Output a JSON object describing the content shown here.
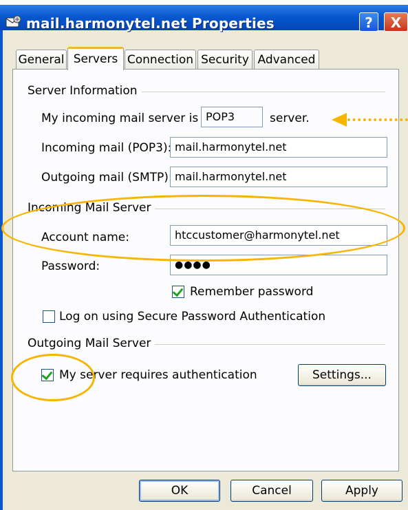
{
  "window": {
    "title": "mail.harmonytel.net Properties",
    "help_glyph": "?",
    "close_glyph": "X"
  },
  "tabs": [
    {
      "label": "General"
    },
    {
      "label": "Servers"
    },
    {
      "label": "Connection"
    },
    {
      "label": "Security"
    },
    {
      "label": "Advanced"
    }
  ],
  "server_info": {
    "heading": "Server Information",
    "type_prefix": "My incoming mail server is a",
    "type_value": "POP3",
    "type_suffix": "server.",
    "incoming_label": "Incoming mail (POP3):",
    "incoming_value": "mail.harmonytel.net",
    "outgoing_label": "Outgoing mail (SMTP):",
    "outgoing_value": "mail.harmonytel.net"
  },
  "incoming_server": {
    "heading": "Incoming Mail Server",
    "account_label": "Account name:",
    "account_value": "htccustomer@harmonytel.net",
    "password_label": "Password:",
    "password_value": "●●●●",
    "remember_label": "Remember password",
    "remember_checked": true,
    "spa_label": "Log on using Secure Password Authentication",
    "spa_checked": false
  },
  "outgoing_server": {
    "heading": "Outgoing Mail Server",
    "auth_label": "My server requires authentication",
    "auth_checked": true,
    "settings_label": "Settings..."
  },
  "footer": {
    "ok_label": "OK",
    "cancel_label": "Cancel",
    "apply_label": "Apply"
  },
  "annotations": {
    "color": "#f7b500"
  },
  "icons": {
    "window_icon": "mail-account-icon",
    "checkmark": "check-icon"
  }
}
